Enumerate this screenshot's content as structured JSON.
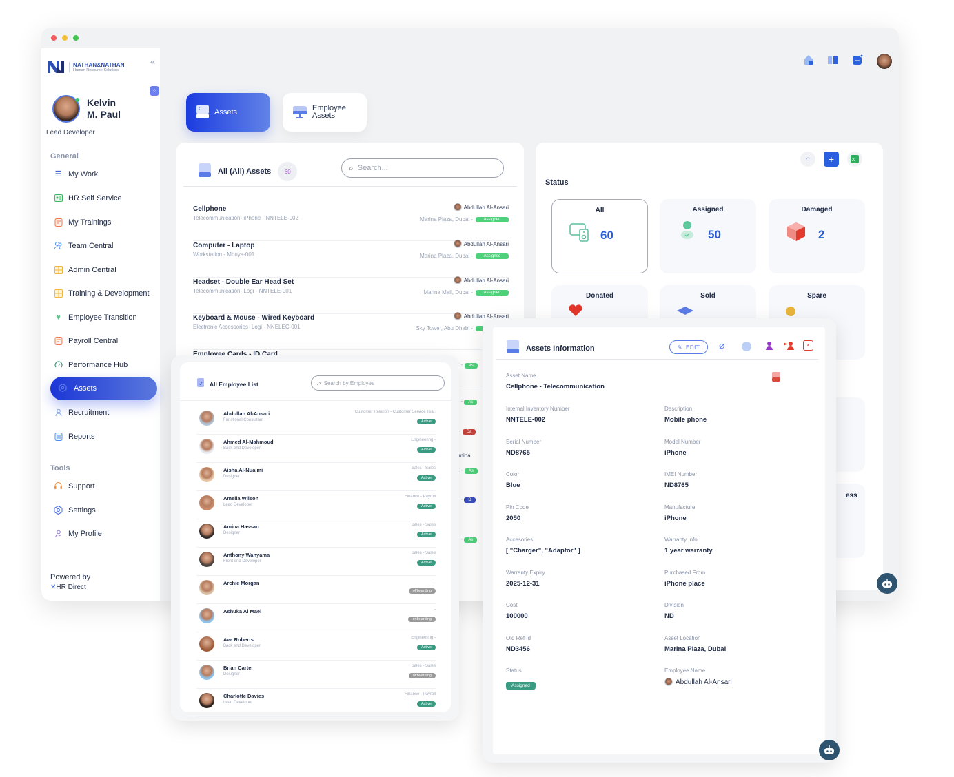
{
  "window_controls": {
    "close_color": "#f05a5a",
    "minimize_color": "#f7bf3a",
    "maximize_color": "#3fc64d"
  },
  "brand": {
    "name": "NATHAN&NATHAN",
    "tagline": "Human Resource Solutions",
    "accent": "#2d4fb4"
  },
  "user": {
    "first_name": "Kelvin",
    "last_name": "M. Paul",
    "role": "Lead Developer"
  },
  "sidebar": {
    "general_label": "General",
    "items": [
      {
        "label": "My Work",
        "icon": "list-check-icon"
      },
      {
        "label": "HR Self Service",
        "icon": "id-card-icon"
      },
      {
        "label": "My Trainings",
        "icon": "document-edit-icon"
      },
      {
        "label": "Team Central",
        "icon": "users-icon"
      },
      {
        "label": "Admin Central",
        "icon": "grid-book-icon"
      },
      {
        "label": "Training & Development",
        "icon": "grid-book-icon"
      },
      {
        "label": "Employee Transition",
        "icon": "handshake-icon"
      },
      {
        "label": "Payroll Central",
        "icon": "document-edit-icon"
      },
      {
        "label": "Performance Hub",
        "icon": "gauge-icon"
      },
      {
        "label": "Assets",
        "icon": "hexagon-icon",
        "active": true
      },
      {
        "label": "Recruitment",
        "icon": "user-add-icon"
      },
      {
        "label": "Reports",
        "icon": "report-icon"
      }
    ],
    "tools_label": "Tools",
    "tools": [
      {
        "label": "Support",
        "icon": "headset-icon"
      },
      {
        "label": "Settings",
        "icon": "gear-icon"
      },
      {
        "label": "My Profile",
        "icon": "user-edit-icon"
      }
    ],
    "powered_by": "Powered by",
    "powered_brand": "HR Direct"
  },
  "tabs": [
    {
      "label": "Assets",
      "active": true
    },
    {
      "label_line1": "Employee",
      "label_line2": "Assets",
      "active": false
    }
  ],
  "assets_list": {
    "title": "All (All) Assets",
    "count": "60",
    "search_placeholder": "Search...",
    "rows": [
      {
        "name": "Cellphone",
        "sub": "Telecommunication- iPhone - NNTELE-002",
        "employee": "Abdullah Al-Ansari",
        "location": "Marina Plaza, Dubai -",
        "status": "Assigned"
      },
      {
        "name": "Computer - Laptop",
        "sub": "Workstation - Mbuya-001",
        "employee": "Abdullah Al-Ansari",
        "location": "Marina Plaza, Dubai -",
        "status": "Assigned"
      },
      {
        "name": "Headset - Double Ear Head Set",
        "sub": "Telecommunication- Logi - NNTELE-001",
        "employee": "Abdullah Al-Ansari",
        "location": "Marina Mall, Dubai -",
        "status": "Assigned"
      },
      {
        "name": "Keyboard & Mouse - Wired Keyboard",
        "sub": "Electronic Accessories- Logi - NNELEC-001",
        "employee": "Abdullah Al-Ansari",
        "location": "Sky Tower, Abu Dhabi -",
        "status": "Assigned"
      },
      {
        "name": "Employee Cards - ID Card",
        "sub": "",
        "employee": "",
        "location": "",
        "status": ""
      }
    ],
    "peek_rows": [
      {
        "loc": "rk -",
        "status": "As",
        "color": "#4fd07a"
      },
      {
        "loc": "bi -",
        "status": "As",
        "color": "#4fd07a"
      },
      {
        "loc": "li -",
        "status": "Da",
        "color": "#c9433b"
      },
      {
        "loc": "rk -",
        "status": "As",
        "color": "#4fd07a",
        "emp": "Amina"
      },
      {
        "loc": "bi -",
        "status": "D",
        "color": "#3a4fbf"
      },
      {
        "loc": "bi -",
        "status": "As",
        "color": "#4fd07a"
      }
    ]
  },
  "status_panel": {
    "title": "Status",
    "cards": [
      {
        "label": "All",
        "count": "60",
        "icon": "devices-icon"
      },
      {
        "label": "Assigned",
        "count": "50",
        "icon": "user-check-icon"
      },
      {
        "label": "Damaged",
        "count": "2",
        "icon": "broken-box-icon"
      },
      {
        "label": "Donated",
        "count": "",
        "icon": "heart-icon"
      },
      {
        "label": "Sold",
        "count": "",
        "icon": "layers-icon"
      },
      {
        "label": "Spare",
        "count": "",
        "icon": "circle-icon"
      }
    ],
    "peek_label": "ess"
  },
  "employee_list": {
    "title": "All Employee List",
    "search_placeholder": "Search by Employee",
    "rows": [
      {
        "name": "Abdullah Al-Ansari",
        "role": "Functional Consultant",
        "dept": "Customer Relation - Customer Service Tea..",
        "status": "Active"
      },
      {
        "name": "Ahmed Al-Mahmoud",
        "role": "Back end Developer",
        "dept": "Engineering -",
        "status": "Active"
      },
      {
        "name": "Aisha Al-Nuaimi",
        "role": "Designer",
        "dept": "Sales - Sales",
        "status": "Active"
      },
      {
        "name": "Amelia Wilson",
        "role": "Lead Developer",
        "dept": "Finance - Payroll",
        "status": "Active"
      },
      {
        "name": "Amina Hassan",
        "role": "Designer",
        "dept": "Sales - Sales",
        "status": "Active"
      },
      {
        "name": "Anthony Wanyama",
        "role": "Front end Developer",
        "dept": "Sales - Sales",
        "status": "Active"
      },
      {
        "name": "Archie Morgan",
        "role": "",
        "dept": "-",
        "status": "offboarding"
      },
      {
        "name": "Ashuka Al Mael",
        "role": "",
        "dept": "-",
        "status": "onboarding"
      },
      {
        "name": "Ava Roberts",
        "role": "Back end Developer",
        "dept": "Engineering -",
        "status": "Active"
      },
      {
        "name": "Brian Carter",
        "role": "Designer",
        "dept": "Sales - Sales",
        "status": "offboarding"
      },
      {
        "name": "Charlotte Davies",
        "role": "Lead Developer",
        "dept": "Finance - Payroll",
        "status": "Active"
      }
    ]
  },
  "asset_info": {
    "title": "Assets Information",
    "edit_label": "EDIT",
    "asset_name_label": "Asset Name",
    "asset_name": "Cellphone - Telecommunication",
    "fields_left": [
      {
        "label": "Internal Inventory Number",
        "value": "NNTELE-002"
      },
      {
        "label": "Serial Number",
        "value": "ND8765"
      },
      {
        "label": "Color",
        "value": "Blue"
      },
      {
        "label": "Pin Code",
        "value": "2050"
      },
      {
        "label": "Accesories",
        "value": "[ \"Charger\", \"Adaptor\" ]"
      },
      {
        "label": "Warranty Expiry",
        "value": "2025-12-31"
      },
      {
        "label": "Cost",
        "value": "100000"
      },
      {
        "label": "Old Ref Id",
        "value": "ND3456"
      },
      {
        "label": "Status",
        "value": "Assigned"
      }
    ],
    "fields_right": [
      {
        "label": "Description",
        "value": "Mobile phone"
      },
      {
        "label": "Model Number",
        "value": "iPhone"
      },
      {
        "label": "IMEI Number",
        "value": "ND8765"
      },
      {
        "label": "Manufacture",
        "value": "iPhone"
      },
      {
        "label": "Warranty Info",
        "value": "1 year warranty"
      },
      {
        "label": "Purchased From",
        "value": "iPhone place"
      },
      {
        "label": "Division",
        "value": "ND"
      },
      {
        "label": "Asset Location",
        "value": "Marina Plaza, Dubai"
      },
      {
        "label": "Employee Name",
        "value": "Abdullah Al-Ansari"
      }
    ]
  }
}
